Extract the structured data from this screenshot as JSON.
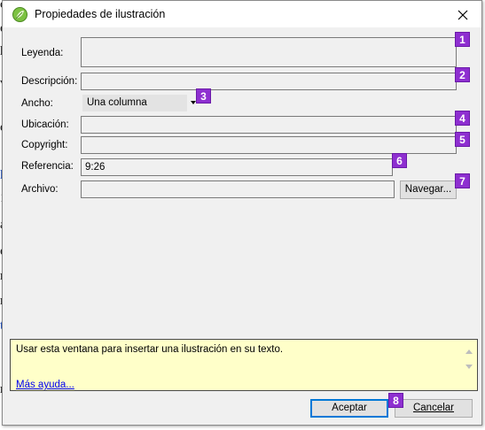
{
  "window": {
    "title": "Propiedades de ilustración",
    "app_icon": "leaf-icon",
    "close_icon": "close-icon"
  },
  "background_doc": {
    "fragments": [
      "co",
      "e",
      "h",
      "v",
      "o",
      "ha",
      "1",
      "ar",
      "e",
      "rt",
      "re",
      "to",
      "ree"
    ]
  },
  "form": {
    "leyenda": {
      "label": "Leyenda:",
      "value": "",
      "badge": "1"
    },
    "descripcion": {
      "label": "Descripción:",
      "value": "",
      "badge": "2"
    },
    "ancho": {
      "label": "Ancho:",
      "value": "Una columna",
      "badge": "3"
    },
    "ubicacion": {
      "label": "Ubicación:",
      "value": "",
      "badge": "4"
    },
    "copyright": {
      "label": "Copyright:",
      "value": "",
      "badge": "5"
    },
    "referencia": {
      "label": "Referencia:",
      "value": "9:26",
      "badge": "6"
    },
    "archivo": {
      "label": "Archivo:",
      "value": "",
      "badge": "7",
      "browse_label": "Navegar..."
    }
  },
  "help": {
    "text": "Usar esta ventana para insertar una ilustración en su texto.",
    "link": "Más ayuda..."
  },
  "buttons": {
    "ok_label": "Aceptar",
    "cancel_label": "Cancelar",
    "badge": "8"
  },
  "colors": {
    "badge": "#8e2fd0",
    "help_bg": "#ffffc9",
    "dialog_bg": "#f0f0f0",
    "link": "#0000ee",
    "primary_border": "#0078d7"
  }
}
